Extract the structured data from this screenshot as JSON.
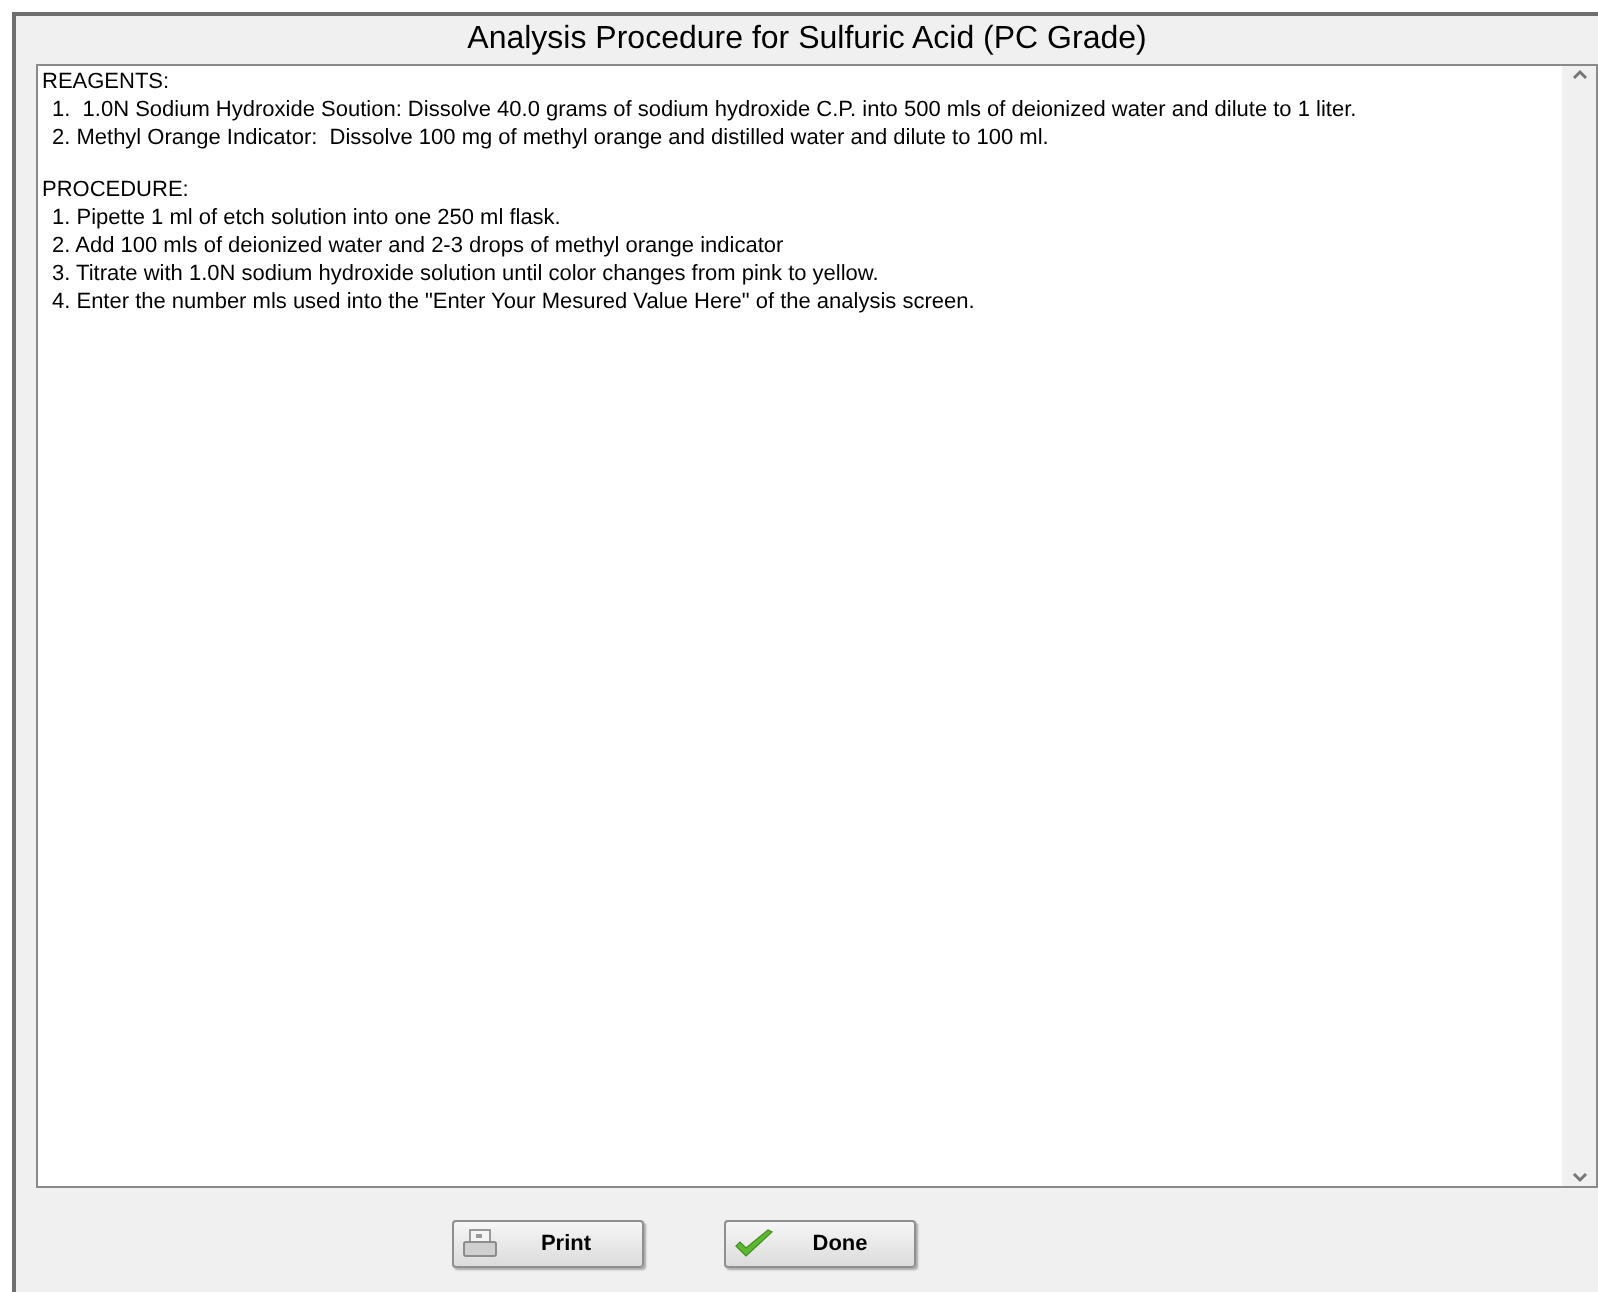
{
  "window": {
    "title": "Analysis Procedure for Sulfuric Acid (PC Grade)"
  },
  "sections": [
    {
      "heading": "REAGENTS:",
      "items": [
        "1.  1.0N Sodium Hydroxide Soution: Dissolve 40.0 grams of sodium hydroxide C.P. into 500 mls of deionized water and dilute to 1 liter.",
        "2. Methyl Orange Indicator:  Dissolve 100 mg of methyl orange and distilled water and dilute to 100 ml."
      ]
    },
    {
      "heading": "PROCEDURE:",
      "items": [
        "1. Pipette 1 ml of etch solution into one 250 ml flask.",
        "2. Add 100 mls of deionized water and 2-3 drops of methyl orange indicator",
        "3. Titrate with 1.0N sodium hydroxide solution until color changes from pink to yellow.",
        "4. Enter the number mls used into the \"Enter Your Mesured Value Here\" of the analysis screen."
      ]
    }
  ],
  "buttons": [
    {
      "kind": "print",
      "label": "Print"
    },
    {
      "kind": "done",
      "label": "Done"
    }
  ]
}
